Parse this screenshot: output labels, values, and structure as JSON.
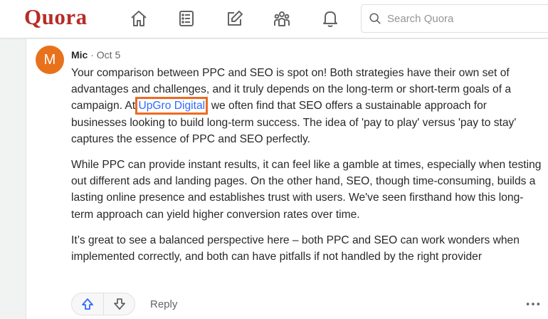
{
  "header": {
    "logo": "Quora",
    "nav": [
      {
        "name": "home-icon"
      },
      {
        "name": "following-icon"
      },
      {
        "name": "answer-icon"
      },
      {
        "name": "spaces-icon"
      },
      {
        "name": "notifications-icon"
      }
    ],
    "search": {
      "placeholder": "Search Quora",
      "value": ""
    }
  },
  "comment": {
    "avatar_letter": "M",
    "author": "Mic",
    "separator": "·",
    "date": "Oct 5",
    "paragraph1_before": "Your comparison between PPC and SEO is spot on! Both strategies have their own set of advantages and challenges, and it truly depends on the long-term or short-term goals of a campaign. At ",
    "paragraph1_link": "UpGro Digital",
    "paragraph1_after": ", we often find that SEO offers a sustainable approach for businesses looking to build long-term success. The idea of 'pay to play' versus 'pay to stay' captures the essence of PPC and SEO perfectly.",
    "paragraph2": "While PPC can provide instant results, it can feel like a gamble at times, especially when testing out different ads and landing pages. On the other hand, SEO, though time-consuming, builds a lasting online presence and establishes trust with users. We've seen firsthand how this long-term approach can yield higher conversion rates over time.",
    "paragraph3": "It’s great to see a balanced perspective here – both PPC and SEO can work wonders when implemented correctly, and both can have pitfalls if not handled by the right provider",
    "reply_label": "Reply"
  },
  "colors": {
    "brand": "#b92b27",
    "link": "#2e69ff",
    "highlight": "#ee6a23",
    "avatar": "#e8711c"
  }
}
